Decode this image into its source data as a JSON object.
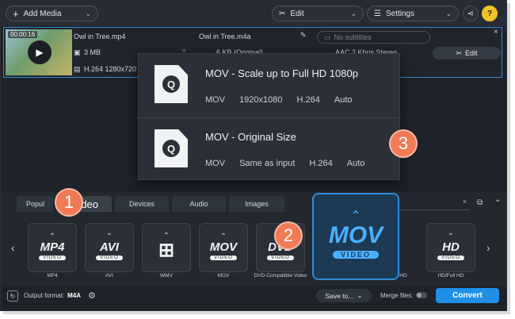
{
  "toolbar": {
    "add_media_label": "Add Media",
    "edit_label": "Edit",
    "settings_label": "Settings",
    "share_icon": "share-icon",
    "help_label": "?"
  },
  "file": {
    "duration": "00:00:16",
    "source_name": "Owl in Tree.mp4",
    "source_size": "3 MB",
    "source_codec": "H.264 1280x720 1",
    "output_name": "Owl in Tree.m4a",
    "output_size": "6 KB (Original)",
    "audio_info": "AAC 2 Kbps Stereo",
    "subtitles_placeholder": "No subtitles",
    "edit_label": "Edit",
    "close_label": "×"
  },
  "popup": {
    "items": [
      {
        "title": "MOV - Scale up to Full HD 1080p",
        "format": "MOV",
        "resolution": "1920x1080",
        "codec": "H.264",
        "quality": "Auto"
      },
      {
        "title": "MOV - Original Size",
        "format": "MOV",
        "resolution": "Same as input",
        "codec": "H.264",
        "quality": "Auto"
      }
    ]
  },
  "badges": {
    "b1": "1",
    "b2": "2",
    "b3": "3"
  },
  "tabs": [
    {
      "label": "Popul"
    },
    {
      "label": "Video"
    },
    {
      "label": "Devices"
    },
    {
      "label": "Audio"
    },
    {
      "label": "Images"
    }
  ],
  "search_clear": "×",
  "formats": [
    {
      "big": "MP4",
      "sub": "VIDEO",
      "label": "MP4"
    },
    {
      "big": "AVI",
      "sub": "VIDEO",
      "label": "AVI"
    },
    {
      "big": "⊞",
      "sub": "",
      "label": "WMV"
    },
    {
      "big": "MOV",
      "sub": "VIDEO",
      "label": "MOV"
    },
    {
      "big": "DVD",
      "sub": "VIDEO",
      "label": "DVD-Compatible Video"
    },
    {
      "big": "HD",
      "sub": "VIDEO",
      "label": "HD/Full HD"
    }
  ],
  "selected_format": {
    "big": "MOV",
    "sub": "VIDEO"
  },
  "hidden_label": "HD",
  "footer": {
    "output_format_label": "Output format:",
    "output_format_value": "M4A",
    "save_to_label": "Save to...",
    "merge_label": "Merge files:",
    "convert_label": "Convert"
  },
  "colors": {
    "accent": "#1f8fe8",
    "badge": "#ef7a55",
    "help": "#f0c22c"
  }
}
